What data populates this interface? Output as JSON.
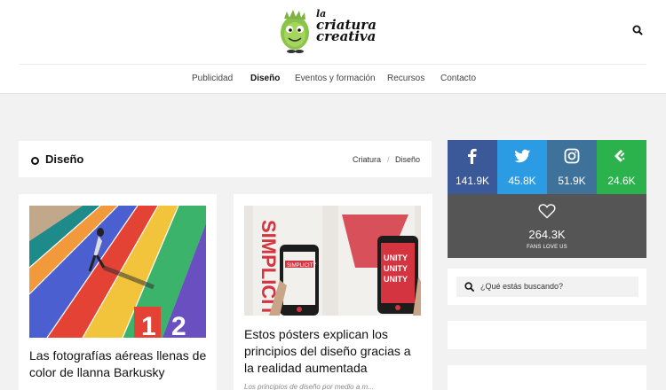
{
  "site": {
    "logo_lines": [
      "la",
      "criatura",
      "creativa"
    ]
  },
  "nav": {
    "items": [
      {
        "label": "Publicidad"
      },
      {
        "label": "Diseño"
      },
      {
        "label": "Eventos y formación"
      },
      {
        "label": "Recursos"
      },
      {
        "label": "Contacto"
      }
    ],
    "active": "Diseño"
  },
  "page": {
    "title": "Diseño",
    "breadcrumb": [
      "Criatura",
      "Diseño"
    ],
    "breadcrumb_sep": "/"
  },
  "articles": [
    {
      "title": "Las fotografías aéreas llenas de color de llanna Barkusky",
      "image_overlay": "1 2"
    },
    {
      "title": "Estos pósters explican los principios del diseño gracias a la realidad aumentada",
      "excerpt": "Los principios de diseño por medio a m...",
      "image_overlay": "UNITY UNITY UNITY"
    }
  ],
  "social": {
    "facebook": {
      "count": "141.9K",
      "color": "#3b5998",
      "icon": "facebook-icon"
    },
    "twitter": {
      "count": "45.8K",
      "color": "#2b9ce3",
      "icon": "twitter-icon"
    },
    "instagram": {
      "count": "51.9K",
      "color": "#3f729b",
      "icon": "instagram-icon"
    },
    "feedly": {
      "count": "24.6K",
      "color": "#2bb24c",
      "icon": "feedly-icon"
    },
    "love": {
      "count": "264.3K",
      "label": "FANS LOVE US",
      "color": "#555555",
      "icon": "heart-icon"
    }
  },
  "search": {
    "placeholder": "¿Qué estás buscando?"
  },
  "colors": {
    "background": "#f2f2f2",
    "card": "#ffffff"
  }
}
